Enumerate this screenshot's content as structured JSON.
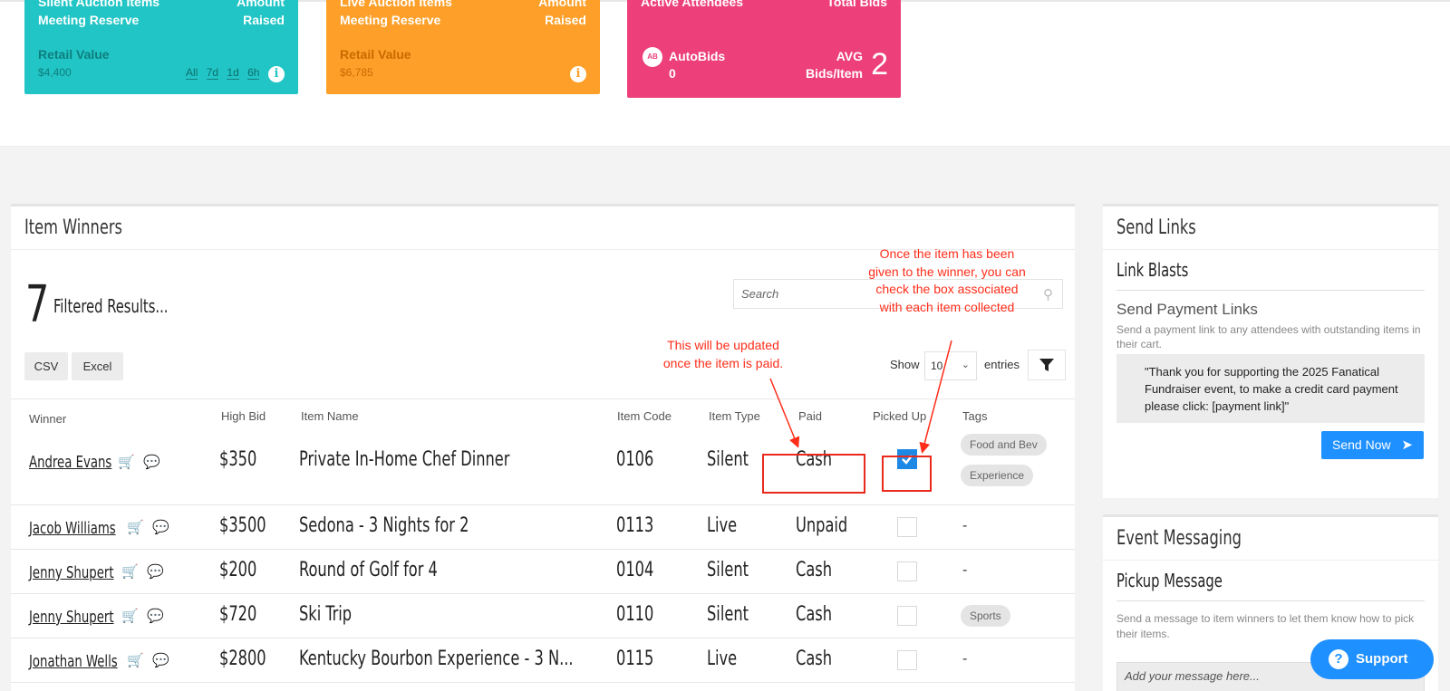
{
  "cards": [
    {
      "title_left": "Silent Auction Items Meeting Reserve",
      "title_right": "Amount Raised",
      "sub_label": "Retail Value",
      "sub_value": "$4,400",
      "filters": [
        "All",
        "7d",
        "1d",
        "6h"
      ],
      "color": "#22c5c5"
    },
    {
      "title_left": "Live Auction Items Meeting Reserve",
      "title_right": "Amount Raised",
      "sub_label": "Retail Value",
      "sub_value": "$6,785",
      "color": "#fd9f28"
    },
    {
      "title_left": "Active Attendees",
      "title_right": "Total Bids",
      "autobids_label": "AutoBids",
      "autobids_value": "0",
      "avg_label": "AVG Bids/Item",
      "avg_value": "2",
      "color": "#ed3f7a"
    }
  ],
  "item_winners": {
    "title": "Item Winners",
    "count": "7",
    "filtered_label": "Filtered Results...",
    "search_placeholder": "Search",
    "export_buttons": [
      "CSV",
      "Excel"
    ],
    "show_label": "Show",
    "show_value": "10",
    "entries_label": "entries",
    "columns": [
      "Winner",
      "High Bid",
      "Item Name",
      "Item Code",
      "Item Type",
      "Paid",
      "Picked Up",
      "Tags"
    ],
    "rows": [
      {
        "winner": "Andrea Evans",
        "high_bid": "$350",
        "item_name": "Private In-Home Chef Dinner",
        "item_code": "0106",
        "item_type": "Silent",
        "paid": "Cash",
        "picked_up": true,
        "tags": [
          "Food and Bev",
          "Experience"
        ]
      },
      {
        "winner": "Jacob Williams",
        "high_bid": "$3500",
        "item_name": "Sedona - 3 Nights for 2",
        "item_code": "0113",
        "item_type": "Live",
        "paid": "Unpaid",
        "picked_up": false,
        "tags": [
          "-"
        ]
      },
      {
        "winner": "Jenny Shupert",
        "high_bid": "$200",
        "item_name": "Round of Golf for 4",
        "item_code": "0104",
        "item_type": "Silent",
        "paid": "Cash",
        "picked_up": false,
        "tags": [
          "-"
        ]
      },
      {
        "winner": "Jenny Shupert",
        "high_bid": "$720",
        "item_name": "Ski Trip",
        "item_code": "0110",
        "item_type": "Silent",
        "paid": "Cash",
        "picked_up": false,
        "tags": [
          "Sports"
        ]
      },
      {
        "winner": "Jonathan Wells",
        "high_bid": "$2800",
        "item_name": "Kentucky Bourbon Experience - 3 N...",
        "item_code": "0115",
        "item_type": "Live",
        "paid": "Cash",
        "picked_up": false,
        "tags": [
          "-"
        ]
      }
    ]
  },
  "send_links": {
    "title": "Send Links",
    "section": "Link Blasts",
    "subsection": "Send Payment Links",
    "description": "Send a payment link to any attendees with outstanding items in their cart.",
    "message": "\"Thank you for supporting the 2025 Fanatical Fundraiser event, to make a credit card payment please click: [payment link]\"",
    "button": "Send Now"
  },
  "event_messaging": {
    "title": "Event Messaging",
    "section": "Pickup Message",
    "description": "Send a message to item winners to let them know how to pick their items.",
    "placeholder": "Add your message here..."
  },
  "support_label": "Support",
  "annotations": {
    "paid_note": "This will be updated once the item is paid.",
    "picked_note": "Once the item has been given to the winner, you can check the box associated with each item collected"
  },
  "colors": {
    "annotation": "#ff2d1a",
    "accent": "#1e90ff"
  }
}
